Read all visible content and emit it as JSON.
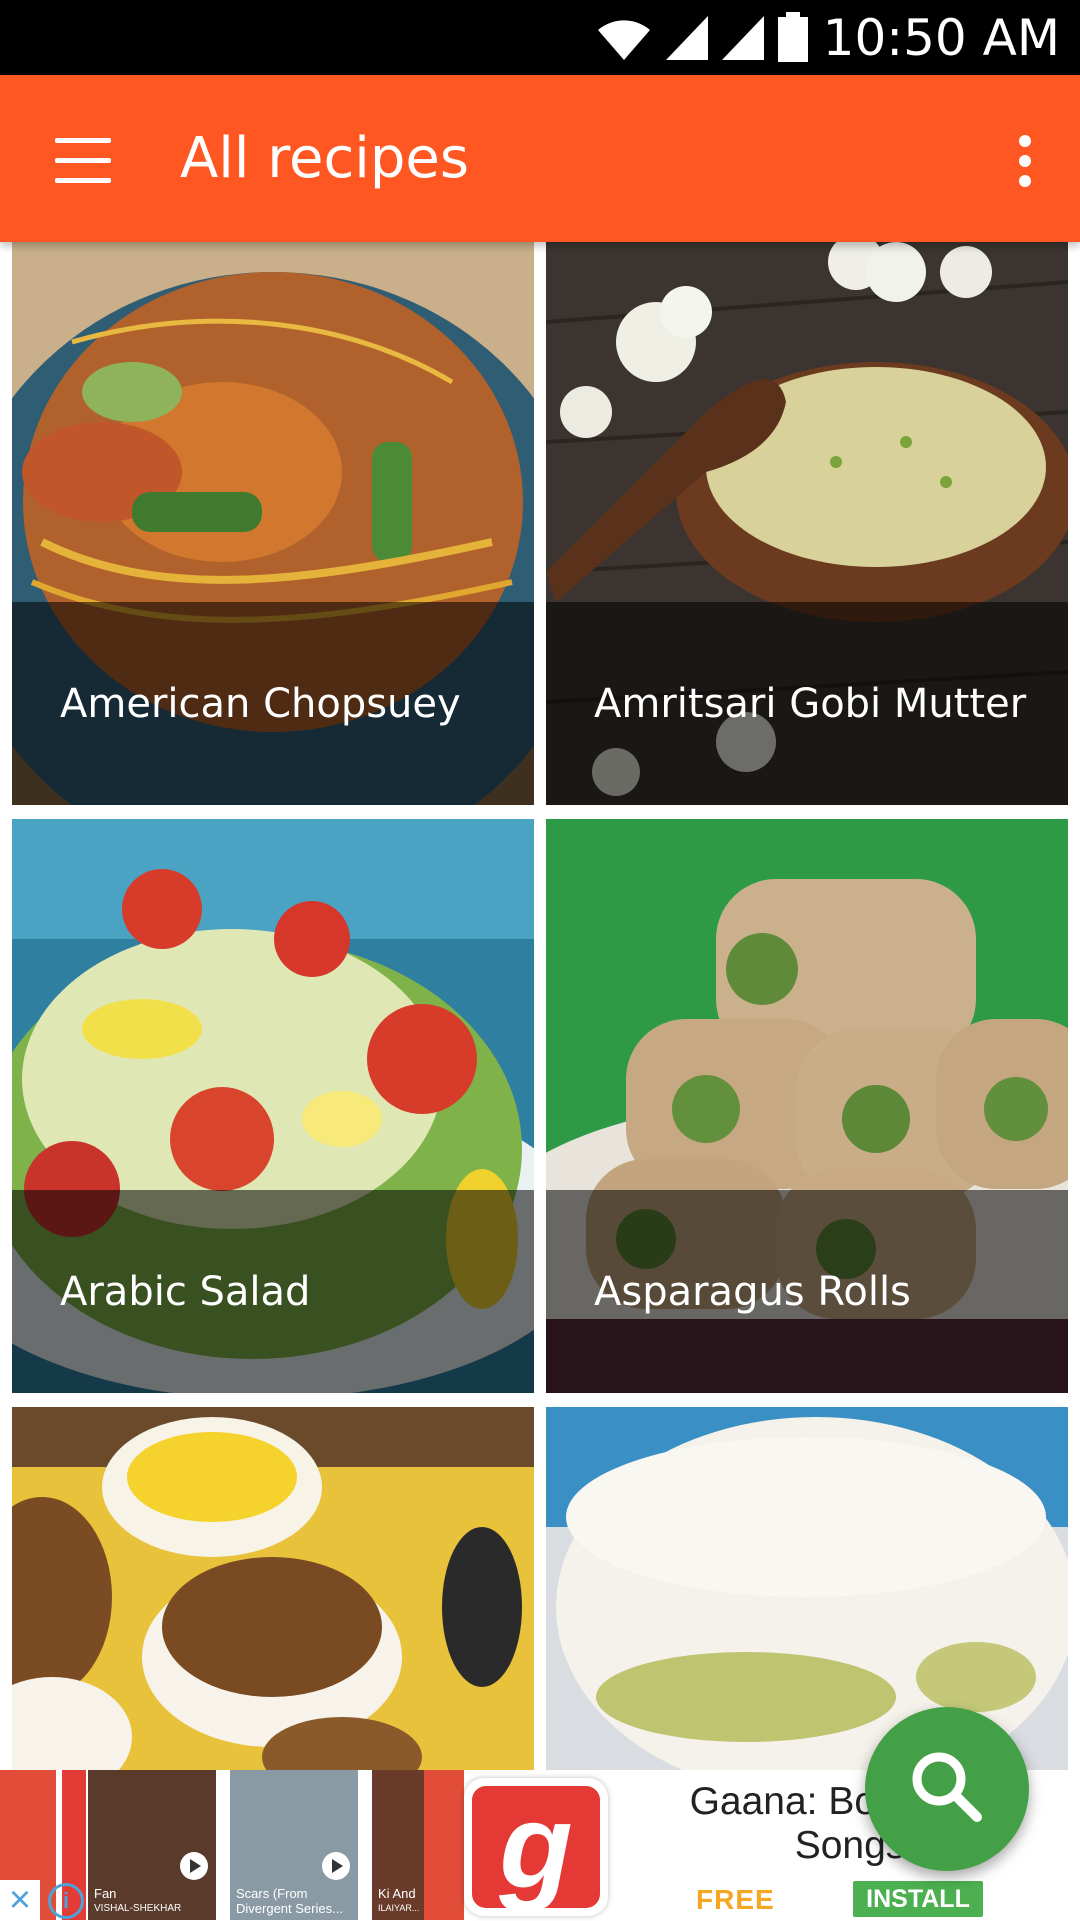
{
  "status_bar": {
    "time": "10:50 AM",
    "icons": [
      "wifi-icon",
      "signal-icon",
      "signal-icon-2",
      "battery-icon"
    ]
  },
  "app_bar": {
    "title": "All recipes",
    "menu_icon": "hamburger-menu-icon",
    "overflow_icon": "more-vertical-icon"
  },
  "recipes": [
    {
      "name": "American Chopsuey"
    },
    {
      "name": "Amritsari Gobi Mutter"
    },
    {
      "name": "Arabic Salad"
    },
    {
      "name": "Asparagus Rolls"
    },
    {
      "name": ""
    },
    {
      "name": ""
    }
  ],
  "fab": {
    "icon": "search-icon"
  },
  "ad": {
    "title": "Gaana: Bollywood Hindi Songs",
    "title_visible": "Gaana: Bollyw…di Songs",
    "price": "FREE",
    "install_label": "INSTALL",
    "thumbs": [
      {
        "caption_line1": "Fan",
        "caption_line2": "VISHAL-SHEKHAR"
      },
      {
        "caption_line1": "Scars (From",
        "caption_line2": "Divergent Series..."
      },
      {
        "caption_line1": "Ki And",
        "caption_line2": "ILAIYAR..."
      }
    ],
    "close_icon": "close-icon",
    "info_icon": "info-icon"
  },
  "colors": {
    "primary": "#ff5722",
    "fab": "#43a047",
    "install": "#4caf50",
    "price": "#f5a623"
  }
}
